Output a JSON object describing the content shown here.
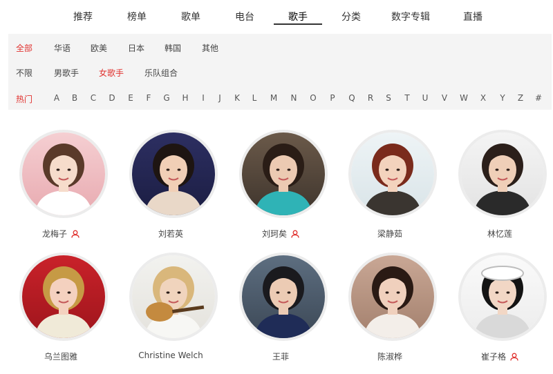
{
  "tabs": [
    {
      "label": "推荐",
      "active": false
    },
    {
      "label": "榜单",
      "active": false
    },
    {
      "label": "歌单",
      "active": false
    },
    {
      "label": "电台",
      "active": false
    },
    {
      "label": "歌手",
      "active": true
    },
    {
      "label": "分类",
      "active": false
    },
    {
      "label": "数字专辑",
      "active": false
    },
    {
      "label": "直播",
      "active": false
    }
  ],
  "filters": {
    "region": {
      "options": [
        "全部",
        "华语",
        "欧美",
        "日本",
        "韩国",
        "其他"
      ],
      "selected": "全部"
    },
    "gender": {
      "options": [
        "不限",
        "男歌手",
        "女歌手",
        "乐队组合"
      ],
      "selected": "女歌手"
    },
    "letters": {
      "options": [
        "热门",
        "A",
        "B",
        "C",
        "D",
        "E",
        "F",
        "G",
        "H",
        "I",
        "J",
        "K",
        "L",
        "M",
        "N",
        "O",
        "P",
        "Q",
        "R",
        "S",
        "T",
        "U",
        "V",
        "W",
        "X",
        "Y",
        "Z",
        "#"
      ],
      "selected": "热门"
    }
  },
  "artists": [
    {
      "name": "龙梅子",
      "verified": true
    },
    {
      "name": "刘若英",
      "verified": false
    },
    {
      "name": "刘珂矣",
      "verified": true
    },
    {
      "name": "梁静茹",
      "verified": false
    },
    {
      "name": "林忆莲",
      "verified": false
    },
    {
      "name": "乌兰图雅",
      "verified": false
    },
    {
      "name": "Christine Welch",
      "verified": false
    },
    {
      "name": "王菲",
      "verified": false
    },
    {
      "name": "陈淑桦",
      "verified": false
    },
    {
      "name": "崔子格",
      "verified": true
    }
  ],
  "colors": {
    "accent": "#e0312e",
    "panel_bg": "#f4f4f4",
    "avatar_border": "#ececec"
  },
  "icons": {
    "verified": "user-icon"
  }
}
